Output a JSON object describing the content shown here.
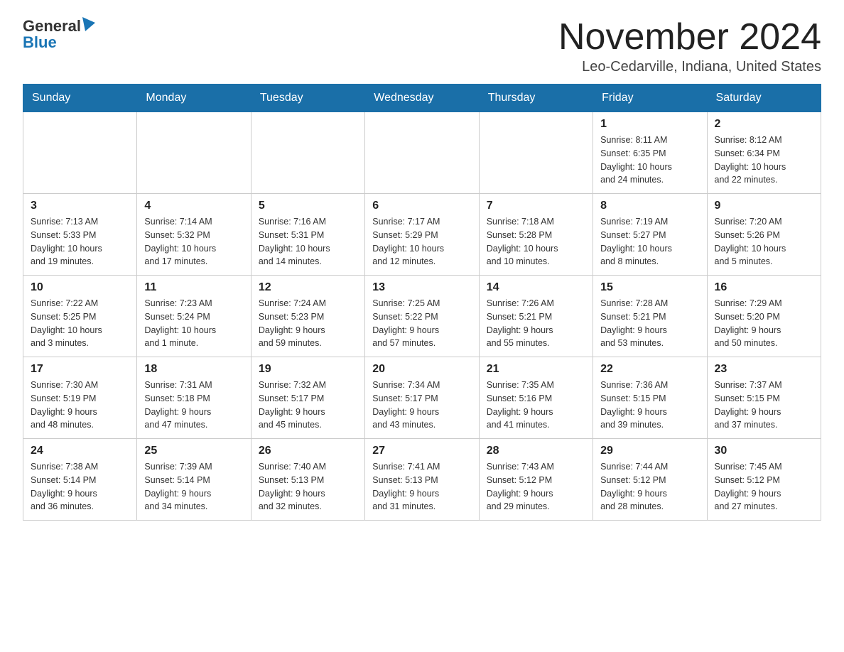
{
  "logo": {
    "general": "General",
    "blue": "Blue"
  },
  "title": "November 2024",
  "location": "Leo-Cedarville, Indiana, United States",
  "days_of_week": [
    "Sunday",
    "Monday",
    "Tuesday",
    "Wednesday",
    "Thursday",
    "Friday",
    "Saturday"
  ],
  "weeks": [
    [
      {
        "day": "",
        "info": ""
      },
      {
        "day": "",
        "info": ""
      },
      {
        "day": "",
        "info": ""
      },
      {
        "day": "",
        "info": ""
      },
      {
        "day": "",
        "info": ""
      },
      {
        "day": "1",
        "info": "Sunrise: 8:11 AM\nSunset: 6:35 PM\nDaylight: 10 hours\nand 24 minutes."
      },
      {
        "day": "2",
        "info": "Sunrise: 8:12 AM\nSunset: 6:34 PM\nDaylight: 10 hours\nand 22 minutes."
      }
    ],
    [
      {
        "day": "3",
        "info": "Sunrise: 7:13 AM\nSunset: 5:33 PM\nDaylight: 10 hours\nand 19 minutes."
      },
      {
        "day": "4",
        "info": "Sunrise: 7:14 AM\nSunset: 5:32 PM\nDaylight: 10 hours\nand 17 minutes."
      },
      {
        "day": "5",
        "info": "Sunrise: 7:16 AM\nSunset: 5:31 PM\nDaylight: 10 hours\nand 14 minutes."
      },
      {
        "day": "6",
        "info": "Sunrise: 7:17 AM\nSunset: 5:29 PM\nDaylight: 10 hours\nand 12 minutes."
      },
      {
        "day": "7",
        "info": "Sunrise: 7:18 AM\nSunset: 5:28 PM\nDaylight: 10 hours\nand 10 minutes."
      },
      {
        "day": "8",
        "info": "Sunrise: 7:19 AM\nSunset: 5:27 PM\nDaylight: 10 hours\nand 8 minutes."
      },
      {
        "day": "9",
        "info": "Sunrise: 7:20 AM\nSunset: 5:26 PM\nDaylight: 10 hours\nand 5 minutes."
      }
    ],
    [
      {
        "day": "10",
        "info": "Sunrise: 7:22 AM\nSunset: 5:25 PM\nDaylight: 10 hours\nand 3 minutes."
      },
      {
        "day": "11",
        "info": "Sunrise: 7:23 AM\nSunset: 5:24 PM\nDaylight: 10 hours\nand 1 minute."
      },
      {
        "day": "12",
        "info": "Sunrise: 7:24 AM\nSunset: 5:23 PM\nDaylight: 9 hours\nand 59 minutes."
      },
      {
        "day": "13",
        "info": "Sunrise: 7:25 AM\nSunset: 5:22 PM\nDaylight: 9 hours\nand 57 minutes."
      },
      {
        "day": "14",
        "info": "Sunrise: 7:26 AM\nSunset: 5:21 PM\nDaylight: 9 hours\nand 55 minutes."
      },
      {
        "day": "15",
        "info": "Sunrise: 7:28 AM\nSunset: 5:21 PM\nDaylight: 9 hours\nand 53 minutes."
      },
      {
        "day": "16",
        "info": "Sunrise: 7:29 AM\nSunset: 5:20 PM\nDaylight: 9 hours\nand 50 minutes."
      }
    ],
    [
      {
        "day": "17",
        "info": "Sunrise: 7:30 AM\nSunset: 5:19 PM\nDaylight: 9 hours\nand 48 minutes."
      },
      {
        "day": "18",
        "info": "Sunrise: 7:31 AM\nSunset: 5:18 PM\nDaylight: 9 hours\nand 47 minutes."
      },
      {
        "day": "19",
        "info": "Sunrise: 7:32 AM\nSunset: 5:17 PM\nDaylight: 9 hours\nand 45 minutes."
      },
      {
        "day": "20",
        "info": "Sunrise: 7:34 AM\nSunset: 5:17 PM\nDaylight: 9 hours\nand 43 minutes."
      },
      {
        "day": "21",
        "info": "Sunrise: 7:35 AM\nSunset: 5:16 PM\nDaylight: 9 hours\nand 41 minutes."
      },
      {
        "day": "22",
        "info": "Sunrise: 7:36 AM\nSunset: 5:15 PM\nDaylight: 9 hours\nand 39 minutes."
      },
      {
        "day": "23",
        "info": "Sunrise: 7:37 AM\nSunset: 5:15 PM\nDaylight: 9 hours\nand 37 minutes."
      }
    ],
    [
      {
        "day": "24",
        "info": "Sunrise: 7:38 AM\nSunset: 5:14 PM\nDaylight: 9 hours\nand 36 minutes."
      },
      {
        "day": "25",
        "info": "Sunrise: 7:39 AM\nSunset: 5:14 PM\nDaylight: 9 hours\nand 34 minutes."
      },
      {
        "day": "26",
        "info": "Sunrise: 7:40 AM\nSunset: 5:13 PM\nDaylight: 9 hours\nand 32 minutes."
      },
      {
        "day": "27",
        "info": "Sunrise: 7:41 AM\nSunset: 5:13 PM\nDaylight: 9 hours\nand 31 minutes."
      },
      {
        "day": "28",
        "info": "Sunrise: 7:43 AM\nSunset: 5:12 PM\nDaylight: 9 hours\nand 29 minutes."
      },
      {
        "day": "29",
        "info": "Sunrise: 7:44 AM\nSunset: 5:12 PM\nDaylight: 9 hours\nand 28 minutes."
      },
      {
        "day": "30",
        "info": "Sunrise: 7:45 AM\nSunset: 5:12 PM\nDaylight: 9 hours\nand 27 minutes."
      }
    ]
  ]
}
